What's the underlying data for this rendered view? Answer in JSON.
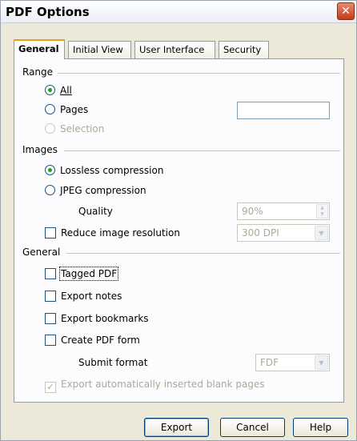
{
  "window": {
    "title": "PDF Options",
    "close_glyph": "✕"
  },
  "tabs": [
    {
      "label": "General",
      "active": true
    },
    {
      "label": "Initial View",
      "active": false
    },
    {
      "label": "User Interface",
      "active": false
    },
    {
      "label": "Security",
      "active": false
    }
  ],
  "range": {
    "heading": "Range",
    "all": {
      "label": "All",
      "selected": true
    },
    "pages": {
      "label": "Pages",
      "selected": false,
      "value": ""
    },
    "selection": {
      "label": "Selection",
      "enabled": false
    }
  },
  "images": {
    "heading": "Images",
    "lossless": {
      "label": "Lossless compression",
      "selected": true
    },
    "jpeg": {
      "label": "JPEG compression",
      "selected": false
    },
    "quality": {
      "label": "Quality",
      "value": "90%"
    },
    "reduce": {
      "label": "Reduce image resolution",
      "checked": false,
      "value": "300 DPI"
    }
  },
  "general": {
    "heading": "General",
    "tagged_pdf": {
      "label": "Tagged PDF",
      "checked": false
    },
    "export_notes": {
      "label": "Export notes",
      "checked": false
    },
    "export_bookmarks": {
      "label": "Export bookmarks",
      "checked": false
    },
    "create_form": {
      "label": "Create PDF form",
      "checked": false
    },
    "submit_format": {
      "label": "Submit format",
      "value": "FDF"
    },
    "blank_pages": {
      "label": "Export automatically inserted blank pages",
      "checked": true,
      "enabled": false
    }
  },
  "buttons": {
    "export": "Export",
    "cancel": "Cancel",
    "help": "Help"
  },
  "colors": {
    "accent_tab": "#e3a21a",
    "radio_dot": "#21a121",
    "border": "#1c5180"
  }
}
